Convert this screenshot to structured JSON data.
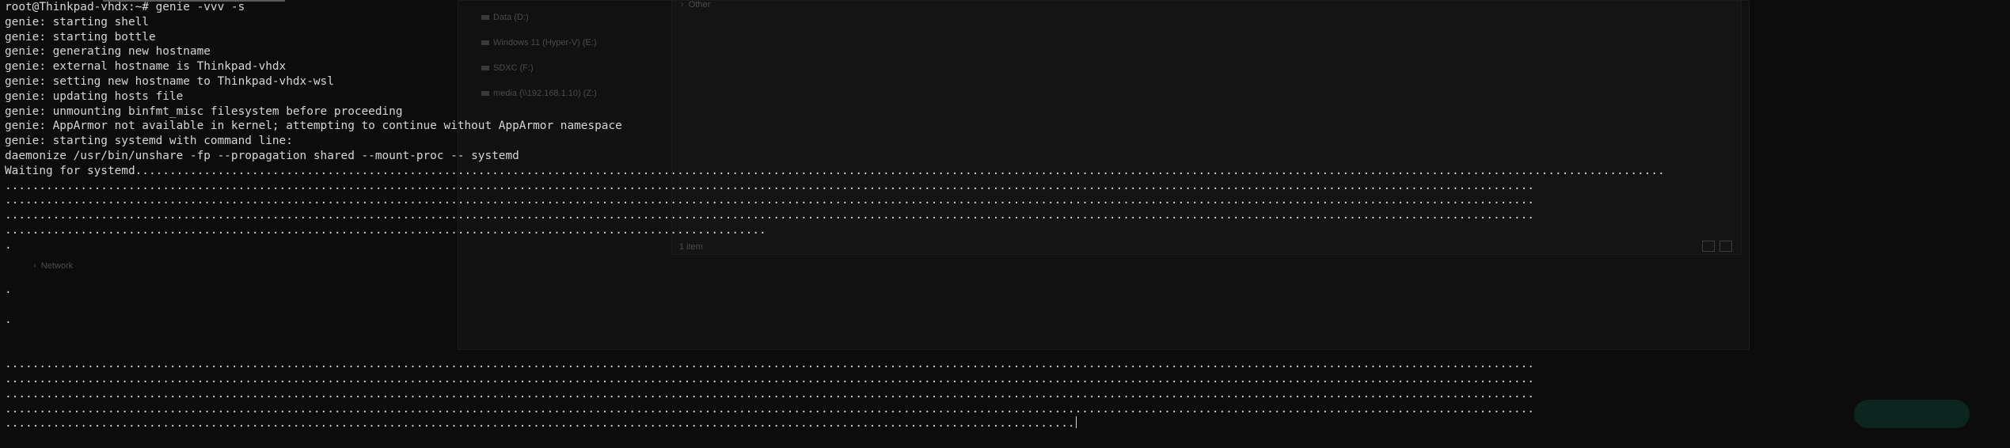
{
  "terminal": {
    "prompt": "root@Thinkpad-vhdx:~# genie -vvv -s",
    "lines": [
      "genie: starting shell",
      "genie: starting bottle",
      "genie: generating new hostname",
      "genie: external hostname is Thinkpad-vhdx",
      "genie: setting new hostname to Thinkpad-vhdx-wsl",
      "genie: updating hosts file",
      "genie: unmounting binfmt_misc filesystem before proceeding",
      "genie: AppArmor not available in kernel; attempting to continue without AppArmor namespace",
      "genie: starting systemd with command line:",
      "daemonize /usr/bin/unshare -fp --propagation shared --mount-proc -- systemd",
      "Waiting for systemd",
      "",
      "",
      "",
      "",
      ".",
      "",
      "",
      ".",
      "",
      ".",
      "",
      "",
      "",
      "",
      "",
      "",
      ""
    ]
  },
  "background_window": {
    "drives": [
      "Data (D:)",
      "Windows 11 (Hyper-V) (E:)",
      "SDXC (F:)",
      "media (\\\\192.168.1.10) (Z:)"
    ],
    "sidebar_item": "Network",
    "panel_item": "Other",
    "status_text": "1 item"
  },
  "colors": {
    "terminal_bg": "#0c0c0c",
    "terminal_fg": "#d6d6d6",
    "accent_button": "#0f3a30"
  }
}
